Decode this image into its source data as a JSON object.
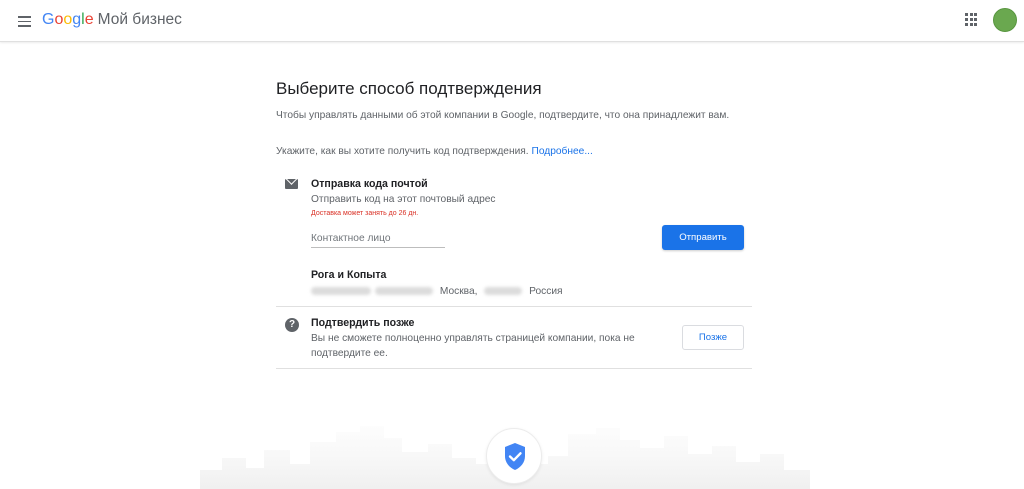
{
  "header": {
    "logo_letters": [
      "G",
      "o",
      "o",
      "g",
      "l",
      "e"
    ],
    "product": "Мой бизнес"
  },
  "main": {
    "title": "Выберите способ подтверждения",
    "description": "Чтобы управлять данными об этой компании в Google, подтвердите, что она принадлежит вам.",
    "hint": "Укажите, как вы хотите получить код подтверждения.",
    "learn_more": "Подробнее..."
  },
  "mail_option": {
    "icon": "mail-icon",
    "title": "Отправка кода почтой",
    "subtitle": "Отправить код на этот почтовый адрес",
    "warning": "Доставка может занять до 26 дн.",
    "contact_placeholder": "Контактное лицо",
    "send_label": "Отправить",
    "business_name": "Рога и Копыта",
    "address_city": "Москва,",
    "address_country": "Россия"
  },
  "later_option": {
    "icon": "help-icon",
    "title": "Подтвердить позже",
    "subtitle": "Вы не сможете полноценно управлять страницей компании, пока не подтвердите ее.",
    "button_label": "Позже"
  },
  "colors": {
    "accent": "#1a73e8",
    "warning": "#d93025",
    "avatar": "#6aa84f"
  }
}
